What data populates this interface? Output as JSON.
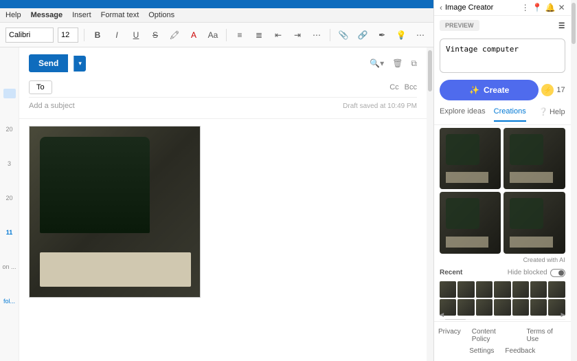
{
  "ribbon": {
    "tabs": [
      "Help",
      "Message",
      "Insert",
      "Format text",
      "Options"
    ],
    "active": "Message"
  },
  "toolbar": {
    "font": "Calibri",
    "size": "12"
  },
  "compose": {
    "send": "Send",
    "to": "To",
    "cc": "Cc",
    "bcc": "Bcc",
    "subject_placeholder": "Add a subject",
    "draft_saved": "Draft saved at 10:49 PM"
  },
  "gutter": {
    "items": [
      "20",
      "3",
      "20",
      "11"
    ],
    "on": "on ...",
    "fol": "fol..."
  },
  "image_creator": {
    "title": "Image Creator",
    "preview": "PREVIEW",
    "prompt": "Vintage computer",
    "create": "Create",
    "credits": "17",
    "tabs": {
      "explore": "Explore ideas",
      "creations": "Creations"
    },
    "help": "Help",
    "ai_tag": "Created with AI",
    "recent": "Recent",
    "hide_blocked": "Hide blocked",
    "footer": {
      "privacy": "Privacy",
      "content_policy": "Content Policy",
      "terms": "Terms of Use",
      "settings": "Settings",
      "feedback": "Feedback"
    }
  }
}
